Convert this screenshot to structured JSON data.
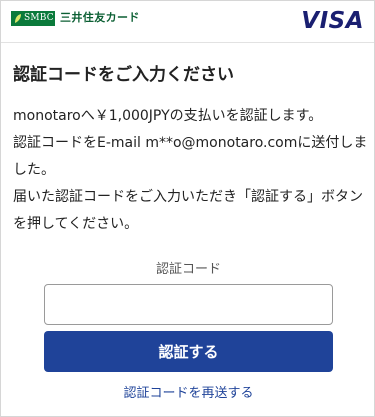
{
  "header": {
    "smbc_logo_text": "SMBC",
    "card_name": "三井住友カード",
    "brand_logo_text": "VISA",
    "colors": {
      "smbc_green": "#0b7a3b",
      "visa_blue": "#1a1f71"
    }
  },
  "main": {
    "title": "認証コードをご入力ください",
    "paragraphs": [
      "monotaroへ￥1,000JPYの支払いを認証します。",
      "認証コードをE-mail m**o@monotaro.comに送付しました。",
      "届いた認証コードをご入力いただき「認証する」ボタンを押してください。"
    ]
  },
  "form": {
    "code_label": "認証コード",
    "code_value": "",
    "submit_label": "認証する",
    "resend_label": "認証コードを再送する",
    "accent_color": "#1f4399"
  }
}
